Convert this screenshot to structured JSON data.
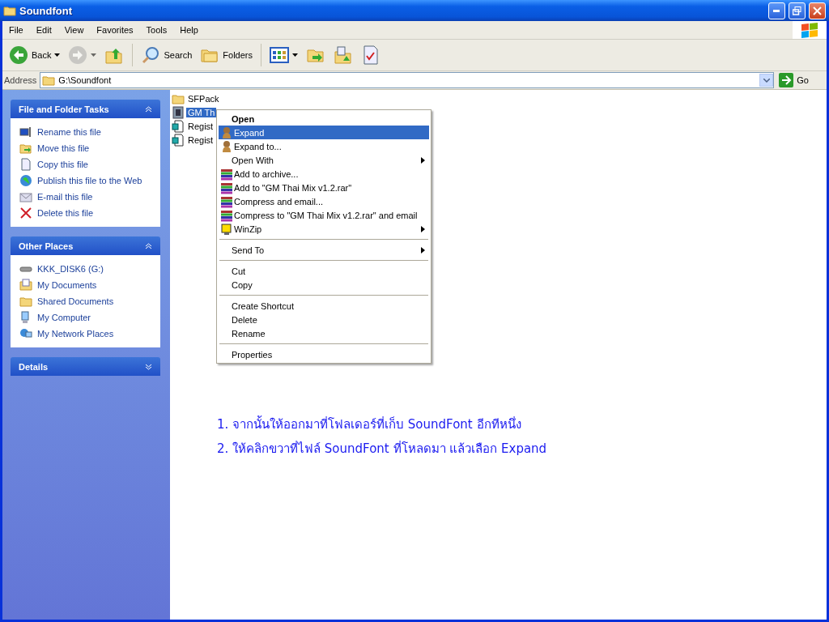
{
  "window": {
    "title": "Soundfont"
  },
  "menu_bar": [
    "File",
    "Edit",
    "View",
    "Favorites",
    "Tools",
    "Help"
  ],
  "toolbar": [
    {
      "kind": "back",
      "label": "Back",
      "disabled": false
    },
    {
      "kind": "forward",
      "disabled": true
    },
    {
      "kind": "up",
      "disabled": false
    },
    {
      "kind": "search",
      "label": "Search",
      "disabled": false
    },
    {
      "kind": "folders",
      "label": "Folders",
      "disabled": false
    },
    {
      "kind": "views",
      "disabled": false
    },
    {
      "kind": "move",
      "disabled": false
    },
    {
      "kind": "copy",
      "disabled": false
    },
    {
      "kind": "properties",
      "disabled": false
    }
  ],
  "address_bar": {
    "label": "Address",
    "value": "G:\\Soundfont",
    "go": "Go"
  },
  "sidebar": [
    {
      "title": "File and Folder Tasks",
      "expanded": true,
      "items": [
        {
          "kind": "rename",
          "label": "Rename this file"
        },
        {
          "kind": "move",
          "label": "Move this file"
        },
        {
          "kind": "copy",
          "label": "Copy this file"
        },
        {
          "kind": "web",
          "label": "Publish this file to the Web"
        },
        {
          "kind": "email",
          "label": "E-mail this file"
        },
        {
          "kind": "delete",
          "label": "Delete this file"
        }
      ]
    },
    {
      "title": "Other Places",
      "expanded": true,
      "items": [
        {
          "kind": "drive",
          "label": "KKK_DISK6 (G:)"
        },
        {
          "kind": "documents",
          "label": "My Documents"
        },
        {
          "kind": "folder",
          "label": "Shared Documents"
        },
        {
          "kind": "computer",
          "label": "My Computer"
        },
        {
          "kind": "network",
          "label": "My Network Places"
        }
      ]
    },
    {
      "title": "Details",
      "expanded": false
    }
  ],
  "files": [
    {
      "kind": "folder",
      "name": "SFPack",
      "selected": false
    },
    {
      "kind": "soundfont",
      "name": "GM Th",
      "selected": true
    },
    {
      "kind": "registry",
      "name": "Regist",
      "selected": false
    },
    {
      "kind": "registry",
      "name": "Regist",
      "selected": false
    }
  ],
  "context_menu": [
    [
      {
        "kind": "plain",
        "label": "Open",
        "default": true,
        "selected": false,
        "submenu": false
      },
      {
        "kind": "expand",
        "label": "Expand",
        "default": false,
        "selected": true,
        "submenu": false
      },
      {
        "kind": "expand",
        "label": "Expand to...",
        "default": false,
        "selected": false,
        "submenu": false
      },
      {
        "kind": "plain",
        "label": "Open With",
        "default": false,
        "selected": false,
        "submenu": true
      },
      {
        "kind": "rar",
        "label": "Add to archive...",
        "default": false,
        "selected": false,
        "submenu": false
      },
      {
        "kind": "rar",
        "label": "Add to \"GM Thai Mix v1.2.rar\"",
        "default": false,
        "selected": false,
        "submenu": false
      },
      {
        "kind": "rar",
        "label": "Compress and email...",
        "default": false,
        "selected": false,
        "submenu": false
      },
      {
        "kind": "rar",
        "label": "Compress to \"GM Thai Mix v1.2.rar\" and email",
        "default": false,
        "selected": false,
        "submenu": false
      },
      {
        "kind": "winzip",
        "label": "WinZip",
        "default": false,
        "selected": false,
        "submenu": true
      }
    ],
    [
      {
        "kind": "plain",
        "label": "Send To",
        "default": false,
        "selected": false,
        "submenu": true
      }
    ],
    [
      {
        "kind": "plain",
        "label": "Cut",
        "default": false,
        "selected": false,
        "submenu": false
      },
      {
        "kind": "plain",
        "label": "Copy",
        "default": false,
        "selected": false,
        "submenu": false
      }
    ],
    [
      {
        "kind": "plain",
        "label": "Create Shortcut",
        "default": false,
        "selected": false,
        "submenu": false
      },
      {
        "kind": "plain",
        "label": "Delete",
        "default": false,
        "selected": false,
        "submenu": false
      },
      {
        "kind": "plain",
        "label": "Rename",
        "default": false,
        "selected": false,
        "submenu": false
      }
    ],
    [
      {
        "kind": "plain",
        "label": "Properties",
        "default": false,
        "selected": false,
        "submenu": false
      }
    ]
  ],
  "instructions": [
    "1. จากนั้นให้ออกมาที่โฟลเดอร์ที่เก็บ SoundFont อีกทีหนึ่ง",
    "2. ให้คลิกขวาที่ไฟล์ SoundFont ที่โหลดมา แล้วเลือก Expand"
  ]
}
